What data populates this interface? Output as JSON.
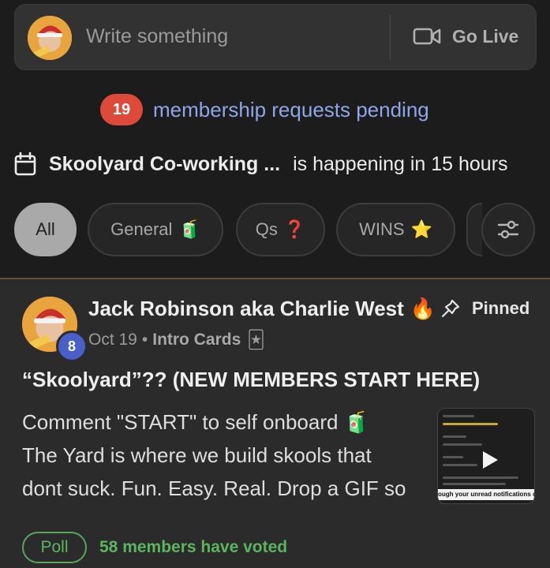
{
  "composer": {
    "placeholder": "Write something",
    "go_live_label": "Go Live",
    "avatar_icon": "santa-avatar"
  },
  "requests": {
    "count": "19",
    "text": "membership requests pending",
    "badge_color": "#de4a3a",
    "text_color": "#8fa6e8"
  },
  "event": {
    "icon": "calendar-icon",
    "name": "Skoolyard Co-working ...",
    "status": "is happening in 15 hours"
  },
  "filters": {
    "chips": [
      {
        "label": "All",
        "emoji": "",
        "active": true
      },
      {
        "label": "General",
        "emoji": "🧃",
        "active": false
      },
      {
        "label": "Qs",
        "emoji": "❓",
        "active": false
      },
      {
        "label": "WINS",
        "emoji": "⭐",
        "active": false
      }
    ],
    "settings_icon": "sliders-icon"
  },
  "post": {
    "author": "Jack Robinson aka Charlie West",
    "author_emoji": "🔥",
    "level": "8",
    "pinned_label": "Pinned",
    "date": "Oct 19",
    "category": "Intro Cards",
    "category_emoji": "🃏",
    "title": "“Skoolyard”?? (NEW MEMBERS START HERE)",
    "body_lines": [
      "Comment \"START\" to self onboard 🧃",
      "The Yard is where we build skools that",
      "dont suck. Fun. Easy. Real. Drop a GIF so"
    ],
    "thumbnail_caption": "ough your unread notifications one by o",
    "poll_label": "Poll",
    "votes": "58 members have voted",
    "accent_green": "#5bb55f"
  }
}
